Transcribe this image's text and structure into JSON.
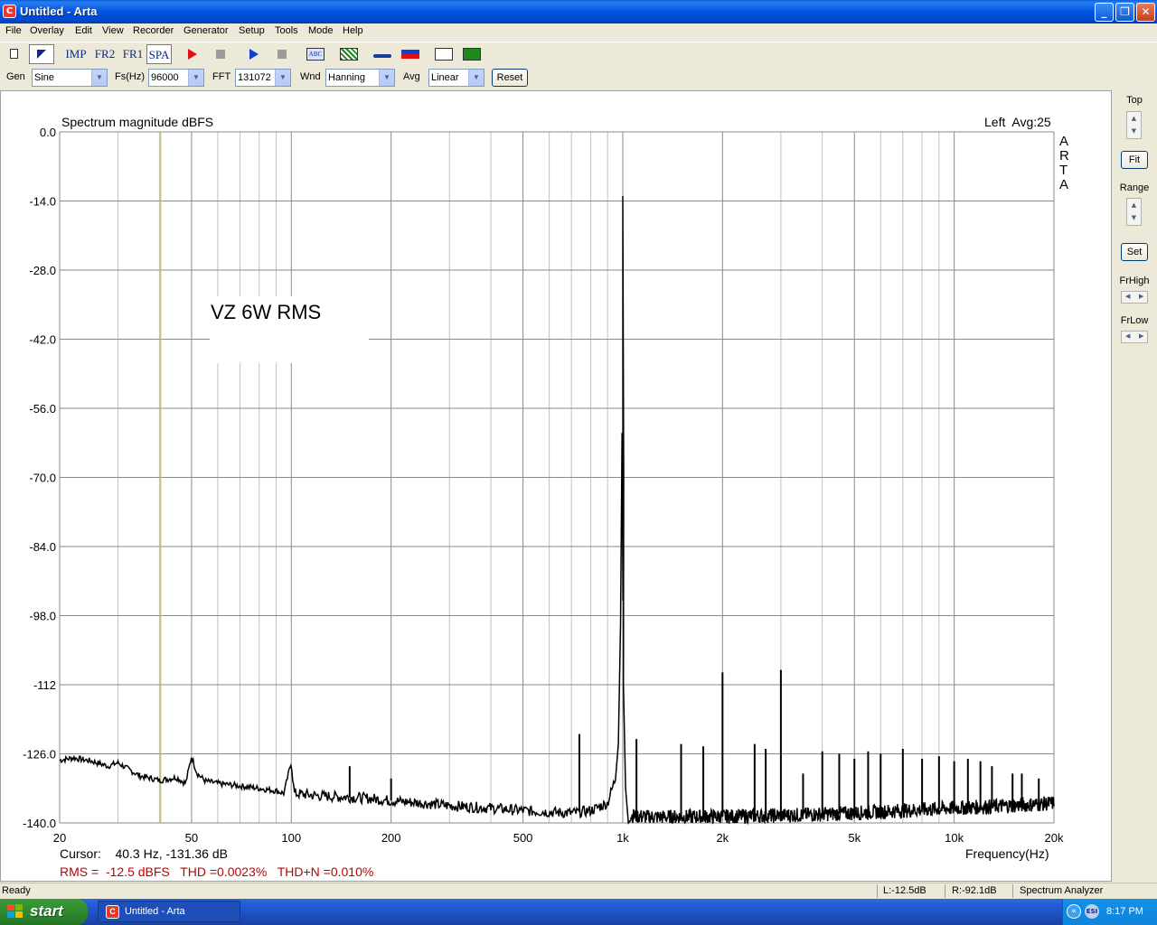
{
  "window": {
    "title": "Untitled - Arta",
    "app_icon": "C",
    "minimize": "_",
    "maximize": "❐",
    "close": "✕"
  },
  "menu": [
    "File",
    "Overlay",
    "Edit",
    "View",
    "Recorder",
    "Generator",
    "Setup",
    "Tools",
    "Mode",
    "Help"
  ],
  "toolbar": {
    "imp": "IMP",
    "fr2": "FR2",
    "fr1": "FR1",
    "spa": "SPA",
    "abc": "ABC"
  },
  "controls": {
    "gen_label": "Gen",
    "gen_value": "Sine",
    "fs_label": "Fs(Hz)",
    "fs_value": "96000",
    "fft_label": "FFT",
    "fft_value": "131072",
    "wnd_label": "Wnd",
    "wnd_value": "Hanning",
    "avg_label": "Avg",
    "avg_value": "Linear",
    "reset": "Reset"
  },
  "side_panel": {
    "top": "Top",
    "fit": "Fit",
    "range": "Range",
    "set": "Set",
    "frhigh": "FrHigh",
    "frlow": "FrLow"
  },
  "chart_data": {
    "type": "line",
    "title": "Spectrum magnitude dBFS",
    "channel_info": "Left  Avg:25",
    "watermark": [
      "A",
      "R",
      "T",
      "A"
    ],
    "annotation": "VZ 6W RMS",
    "xlabel": "Frequency(Hz)",
    "x_scale": "log",
    "xlim": [
      20,
      20000
    ],
    "x_ticks": [
      {
        "value": 20,
        "label": "20"
      },
      {
        "value": 50,
        "label": "50"
      },
      {
        "value": 100,
        "label": "100"
      },
      {
        "value": 200,
        "label": "200"
      },
      {
        "value": 500,
        "label": "500"
      },
      {
        "value": 1000,
        "label": "1k"
      },
      {
        "value": 2000,
        "label": "2k"
      },
      {
        "value": 5000,
        "label": "5k"
      },
      {
        "value": 10000,
        "label": "10k"
      },
      {
        "value": 20000,
        "label": "20k"
      }
    ],
    "ylim": [
      -140,
      0
    ],
    "y_ticks": [
      "0.0",
      "-14.0",
      "-28.0",
      "-42.0",
      "-56.0",
      "-70.0",
      "-84.0",
      "-98.0",
      "-112",
      "-126.0",
      "-140.0"
    ],
    "cursor_freq": 40.3,
    "cursor_text": "Cursor:    40.3 Hz, -131.36 dB",
    "metrics_text": "RMS =  -12.5 dBFS   THD =0.0023%   THD+N =0.010%",
    "grid": true,
    "color_trace": "#000000",
    "color_cursor": "#d4c44a",
    "color_metrics": "#c00000",
    "noise_floor": [
      [
        20,
        -127.3
      ],
      [
        22,
        -126.8
      ],
      [
        25,
        -127.5
      ],
      [
        28,
        -128.5
      ],
      [
        30,
        -127.8
      ],
      [
        32,
        -129
      ],
      [
        35,
        -130.5
      ],
      [
        38,
        -131
      ],
      [
        40,
        -131.4
      ],
      [
        45,
        -130.8
      ],
      [
        48,
        -132
      ],
      [
        50,
        -126.5
      ],
      [
        52,
        -130
      ],
      [
        55,
        -131.5
      ],
      [
        60,
        -132
      ],
      [
        70,
        -132.5
      ],
      [
        80,
        -133
      ],
      [
        90,
        -133.5
      ],
      [
        95,
        -134
      ],
      [
        100,
        -127.5
      ],
      [
        102,
        -134
      ],
      [
        120,
        -134.5
      ],
      [
        150,
        -134.8
      ],
      [
        170,
        -135
      ],
      [
        200,
        -135.5
      ],
      [
        250,
        -136
      ],
      [
        300,
        -136.5
      ],
      [
        400,
        -137
      ],
      [
        500,
        -137.5
      ],
      [
        600,
        -137.8
      ],
      [
        700,
        -138
      ],
      [
        800,
        -137.5
      ],
      [
        900,
        -136
      ],
      [
        950,
        -131
      ]
    ],
    "fundamental": {
      "freq": 1000,
      "peak": -13.0
    },
    "sideband_peak": {
      "freq": 995,
      "peak": -61.0
    },
    "noise_floor_high": [
      [
        1050,
        -138.5
      ],
      [
        1200,
        -138.8
      ],
      [
        1500,
        -138.8
      ],
      [
        2000,
        -138.7
      ],
      [
        3000,
        -138.5
      ],
      [
        5000,
        -138
      ],
      [
        7000,
        -137.5
      ],
      [
        10000,
        -137
      ],
      [
        15000,
        -136.5
      ],
      [
        20000,
        -136
      ]
    ],
    "spikes": [
      {
        "freq": 150,
        "db": -128.5
      },
      {
        "freq": 200,
        "db": -131
      },
      {
        "freq": 740,
        "db": -122
      },
      {
        "freq": 1100,
        "db": -123
      },
      {
        "freq": 1500,
        "db": -124
      },
      {
        "freq": 1750,
        "db": -124.5
      },
      {
        "freq": 2000,
        "db": -109.5
      },
      {
        "freq": 2500,
        "db": -124
      },
      {
        "freq": 2700,
        "db": -125
      },
      {
        "freq": 3000,
        "db": -109
      },
      {
        "freq": 3500,
        "db": -130
      },
      {
        "freq": 4000,
        "db": -125.5
      },
      {
        "freq": 4500,
        "db": -126
      },
      {
        "freq": 5000,
        "db": -127
      },
      {
        "freq": 5500,
        "db": -125.5
      },
      {
        "freq": 6000,
        "db": -126
      },
      {
        "freq": 7000,
        "db": -125
      },
      {
        "freq": 8000,
        "db": -127
      },
      {
        "freq": 9000,
        "db": -126.5
      },
      {
        "freq": 10000,
        "db": -127.5
      },
      {
        "freq": 11000,
        "db": -127
      },
      {
        "freq": 12000,
        "db": -127.5
      },
      {
        "freq": 13000,
        "db": -128.5
      },
      {
        "freq": 15000,
        "db": -130
      },
      {
        "freq": 16000,
        "db": -130
      },
      {
        "freq": 18000,
        "db": -131
      }
    ]
  },
  "statusbar": {
    "ready": "Ready",
    "left": "L:-12.5dB",
    "right": "R:-92.1dB",
    "mode": "Spectrum Analyzer"
  },
  "taskbar": {
    "start": "start",
    "task": "Untitled - Arta",
    "tray_icon": "ESI",
    "clock": "8:17 PM"
  }
}
